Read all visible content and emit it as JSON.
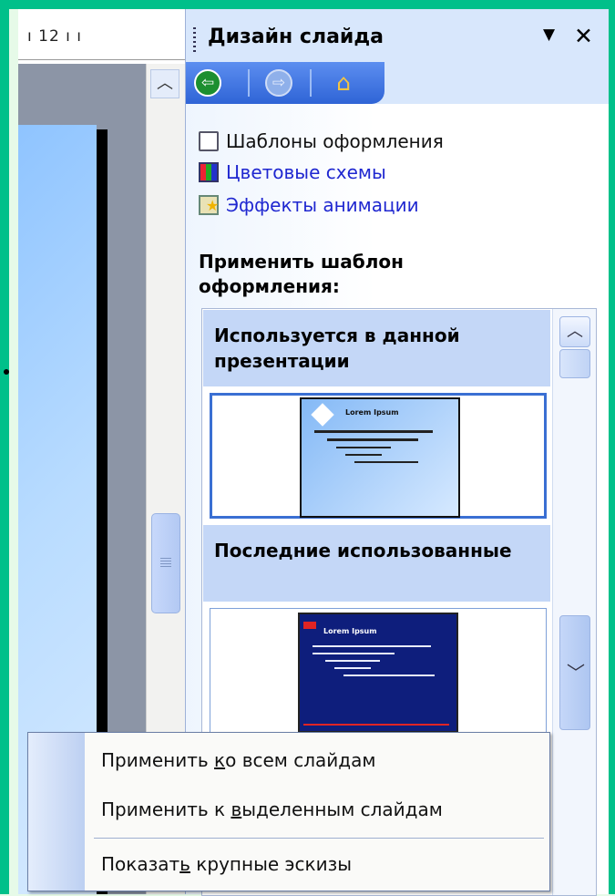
{
  "ruler": {
    "text": "ı 12 ı ı"
  },
  "pane": {
    "title": "Дизайн слайда",
    "dropdown_glyph": "▼",
    "close_glyph": "✕"
  },
  "nav": {
    "back_glyph": "⇦",
    "forward_glyph": "⇨"
  },
  "links": [
    {
      "label": "Шаблоны оформления",
      "icon": "design-template-icon"
    },
    {
      "label": "Цветовые схемы",
      "icon": "color-scheme-icon"
    },
    {
      "label": "Эффекты анимации",
      "icon": "animation-effects-icon"
    }
  ],
  "apply_header": "Применить шаблон оформления:",
  "gallery": {
    "section_used": "Используется в данной презентации",
    "section_recent": "Последние использованные",
    "thumb1_title": "Lorem Ipsum",
    "thumb2_title": "Lorem Ipsum"
  },
  "menu": {
    "items": [
      {
        "pre": "Применить ",
        "acc": "к",
        "post": "о всем слайдам"
      },
      {
        "pre": "Применить к ",
        "acc": "в",
        "post": "ыделенным слайдам"
      },
      {
        "pre": "Показат",
        "acc": "ь",
        "post": " крупные эскизы"
      }
    ]
  },
  "colors": {
    "frame": "#00c08a",
    "pane_bg": "#d8e7fc",
    "link": "#1f27d0",
    "nav": "#3a6fe0"
  }
}
